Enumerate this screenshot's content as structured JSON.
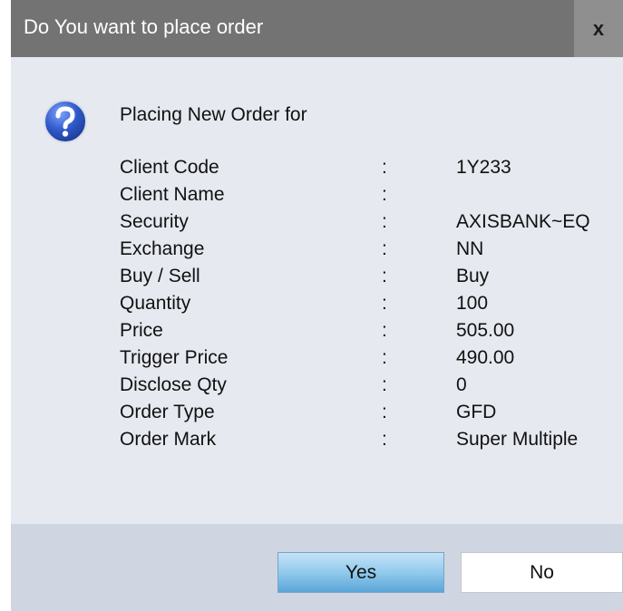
{
  "window": {
    "title": "Do You want to place order",
    "close_glyph": "x"
  },
  "dialog": {
    "icon": "question-icon",
    "heading": "Placing New Order for",
    "separator": ":",
    "fields": [
      {
        "label": "Client Code",
        "value": "1Y233"
      },
      {
        "label": "Client Name",
        "value": ""
      },
      {
        "label": "Security",
        "value": "AXISBANK~EQ"
      },
      {
        "label": "Exchange",
        "value": "NN"
      },
      {
        "label": "Buy / Sell",
        "value": "Buy"
      },
      {
        "label": "Quantity",
        "value": "100"
      },
      {
        "label": "Price",
        "value": "505.00"
      },
      {
        "label": "Trigger Price",
        "value": "490.00"
      },
      {
        "label": "Disclose Qty",
        "value": "0"
      },
      {
        "label": "Order Type",
        "value": "GFD"
      },
      {
        "label": "Order Mark",
        "value": "Super Multiple"
      }
    ]
  },
  "buttons": {
    "yes": "Yes",
    "no": "No"
  },
  "colors": {
    "titlebar": "#737373",
    "content_bg": "#e6e9f0",
    "footer_bg": "#cfd6e2",
    "yes_accent": "#5aa6d8"
  }
}
